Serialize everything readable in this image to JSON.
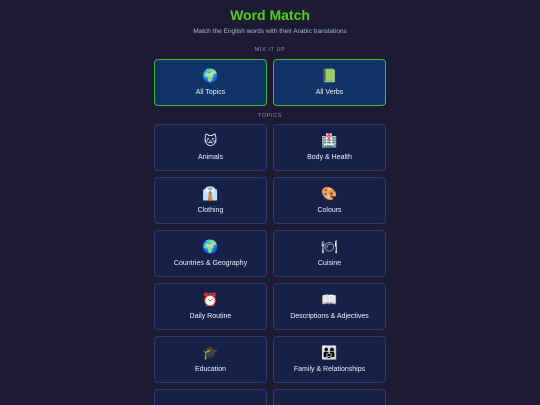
{
  "header": {
    "title": "Word Match",
    "subtitle": "Match the English words with their Arabic translations"
  },
  "mix": {
    "section_label": "MIX IT UP",
    "items": [
      {
        "label": "All Topics",
        "icon": "🌍",
        "icon_name": "globe-icon"
      },
      {
        "label": "All Verbs",
        "icon": "📗",
        "icon_name": "green-book-icon"
      }
    ]
  },
  "topics": {
    "section_label": "TOPICS",
    "items": [
      {
        "label": "Animals",
        "icon": "🐱",
        "icon_name": "cat-face-icon"
      },
      {
        "label": "Body & Health",
        "icon": "🏥",
        "icon_name": "hospital-icon"
      },
      {
        "label": "Clothing",
        "icon": "👔",
        "icon_name": "necktie-shirt-icon"
      },
      {
        "label": "Colours",
        "icon": "🎨",
        "icon_name": "palette-icon"
      },
      {
        "label": "Countries & Geography",
        "icon": "🌍",
        "icon_name": "globe-icon"
      },
      {
        "label": "Cuisine",
        "icon": "🍽",
        "icon_name": "fork-knife-plate-icon"
      },
      {
        "label": "Daily Routine",
        "icon": "⏰",
        "icon_name": "alarm-clock-icon"
      },
      {
        "label": "Descriptions & Adjectives",
        "icon": "📖",
        "icon_name": "open-book-icon"
      },
      {
        "label": "Education",
        "icon": "🎓",
        "icon_name": "graduation-cap-icon"
      },
      {
        "label": "Family & Relationships",
        "icon": "👨‍👩‍👧",
        "icon_name": "family-icon"
      }
    ]
  },
  "colors": {
    "background": "#1c1b33",
    "title": "#4fd11a",
    "card_bg": "#172148",
    "mix_card_bg": "#113466",
    "mix_card_border": "#45b834"
  }
}
